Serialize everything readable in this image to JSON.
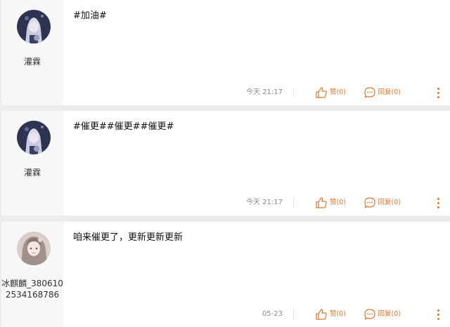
{
  "comments": [
    {
      "username": "灌霖",
      "text": "#加油#",
      "time": "今天 21:17",
      "like_label": "赞(0)",
      "reply_label": "回复(0)"
    },
    {
      "username": "灌霖",
      "text": "#催更##催更##催更#",
      "time": "今天 21:17",
      "like_label": "赞(0)",
      "reply_label": "回复(0)"
    },
    {
      "username": "冰麒麟_3806102534168786",
      "text": "咱来催更了，更新更新更新",
      "time": "05-23",
      "like_label": "赞(0)",
      "reply_label": "回复(0)"
    }
  ],
  "icons": {
    "like": "thumbs-up-icon",
    "reply": "speech-bubble-icon",
    "more": "vertical-ellipsis-icon"
  },
  "colors": {
    "accent": "#e0762b",
    "background": "#ececec",
    "card": "#ffffff",
    "user_column": "#f7f7f7"
  }
}
